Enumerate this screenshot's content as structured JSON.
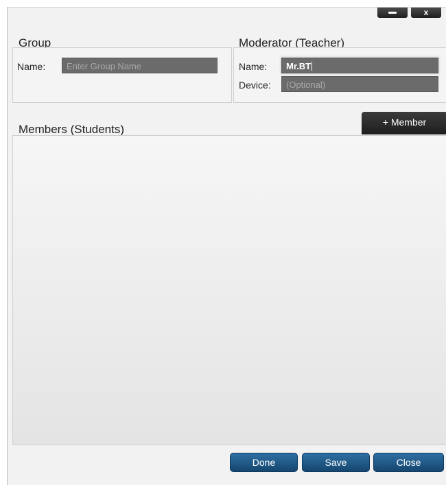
{
  "window": {
    "minimize_icon": "minimize-icon",
    "close_icon": "close-icon",
    "close_glyph": "x"
  },
  "group": {
    "title": "Group",
    "name_label": "Name:",
    "name_placeholder": "Enter Group Name",
    "name_value": ""
  },
  "moderator": {
    "title": "Moderator (Teacher)",
    "name_label": "Name:",
    "name_value": "Mr.BT",
    "device_label": "Device:",
    "device_placeholder": "(Optional)"
  },
  "members": {
    "title": "Members (Students)",
    "add_button": "+ Member",
    "items": []
  },
  "footer": {
    "done": "Done",
    "save": "Save",
    "close": "Close"
  },
  "colors": {
    "field_bg": "#6b6b6b",
    "dark_button": "#1e1e1e",
    "primary_button": "#1f5a8a"
  }
}
